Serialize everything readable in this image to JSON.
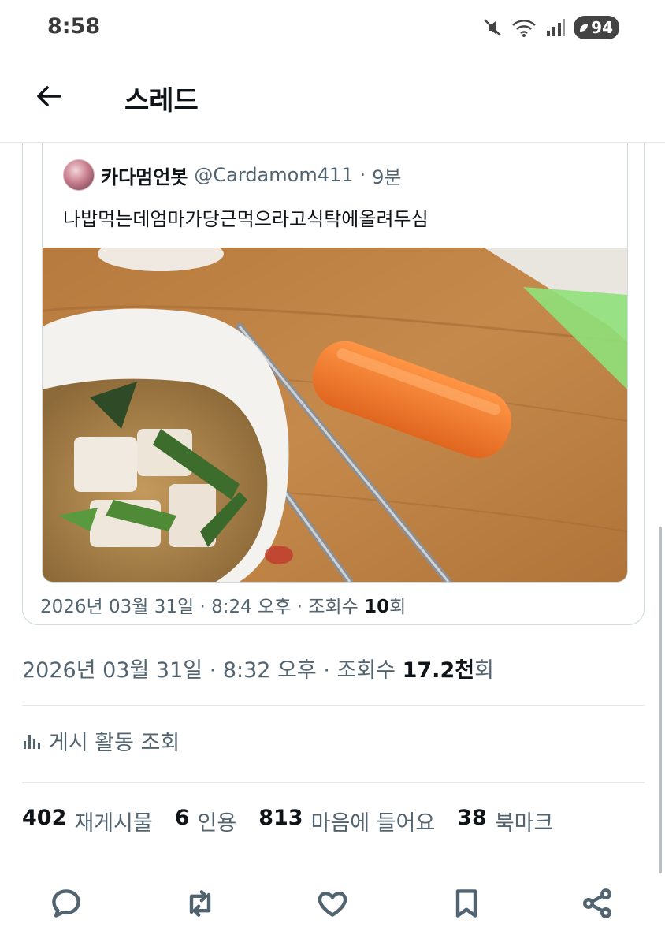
{
  "status_bar": {
    "time": "8:58",
    "battery": "94"
  },
  "header": {
    "title": "스레드"
  },
  "quoted_tweet": {
    "author_name": "카다멈언봇",
    "handle": "@Cardamom411",
    "separator": "·",
    "relative_time": "9분",
    "text": "나밥먹는데엄마가당근먹으라고식탁에올려두심",
    "meta_prefix": "2026년 03월 31일 · 8:24 오후 · 조회수 ",
    "meta_views": "10",
    "meta_suffix": "회"
  },
  "post": {
    "meta_prefix": "2026년 03월 31일 · 8:32 오후 · 조회수 ",
    "views": "17.2천",
    "views_suffix": "회",
    "activity_label": "게시 활동 조회"
  },
  "stats": [
    {
      "count": "402",
      "label": "재게시물"
    },
    {
      "count": "6",
      "label": "인용"
    },
    {
      "count": "813",
      "label": "마음에 들어요"
    },
    {
      "count": "38",
      "label": "북마크"
    }
  ],
  "actions": [
    "reply-icon",
    "repost-icon",
    "like-icon",
    "bookmark-icon",
    "share-icon"
  ],
  "colors": {
    "text": "#0f1419",
    "secondary": "#536471",
    "border": "#cfd9de",
    "carrot": "#f07a2e"
  }
}
